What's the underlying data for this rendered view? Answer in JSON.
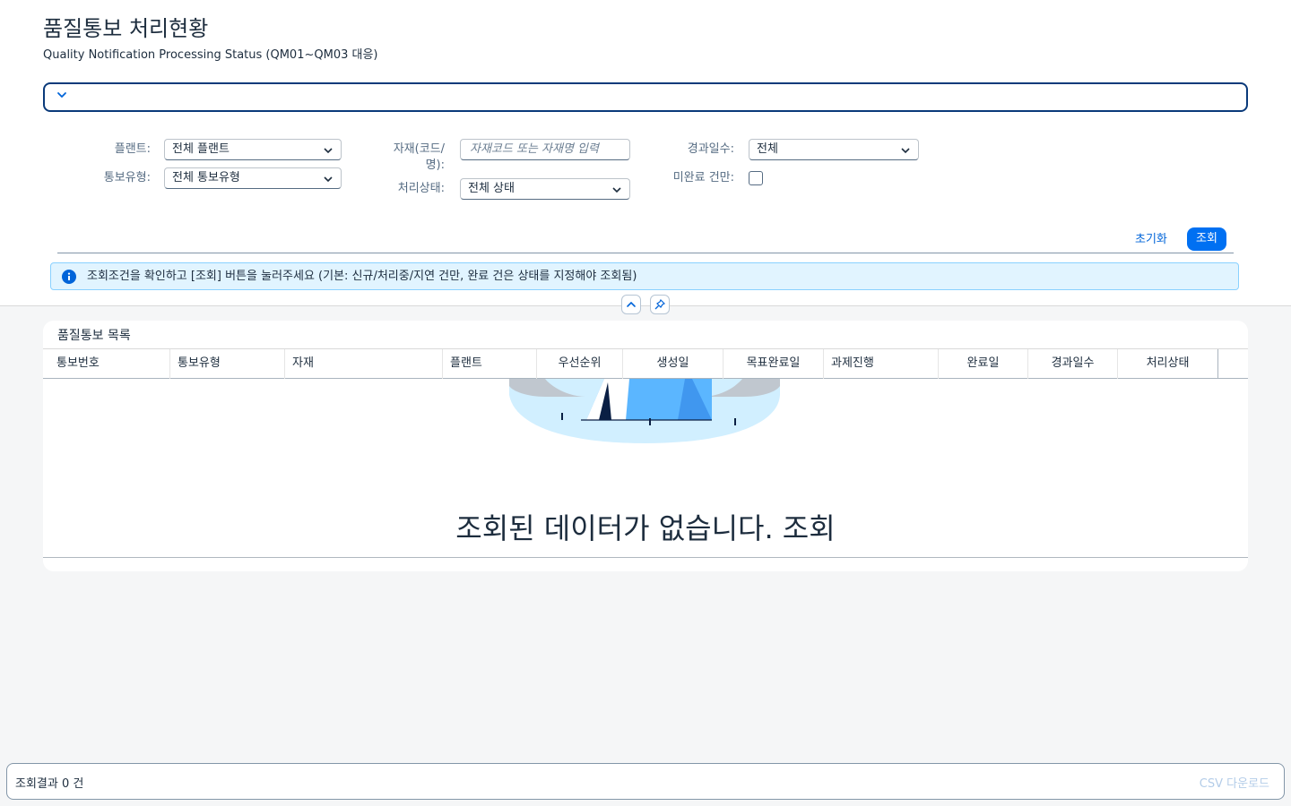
{
  "header": {
    "title": "품질통보 처리현황",
    "subtitle": "Quality Notification Processing Status (QM01~QM03 대응)"
  },
  "filters": {
    "plant": {
      "label": "플랜트:",
      "value": "전체 플랜트"
    },
    "notif_type": {
      "label": "통보유형:",
      "value": "전체 통보유형"
    },
    "material": {
      "label_line1": "자재(코드/",
      "label_line2": "명):",
      "placeholder": "자재코드 또는 자재명 입력"
    },
    "status": {
      "label": "처리상태:",
      "value": "전체 상태"
    },
    "elapsed": {
      "label": "경과일수:",
      "value": "전체"
    },
    "incomplete_only": {
      "label": "미완료 건만:",
      "checked": false
    }
  },
  "actions": {
    "reset_label": "초기화",
    "search_label": "조회"
  },
  "info": {
    "message": "조회조건을 확인하고 [조회] 버튼을 눌러주세요 (기본: 신규/처리중/지연 건만, 완료 건은 상태를 지정해야 조회됨)"
  },
  "table": {
    "title": "품질통보 목록",
    "columns": [
      "통보번호",
      "통보유형",
      "자재",
      "플랜트",
      "우선순위",
      "생성일",
      "목표완료일",
      "과제진행",
      "완료일",
      "경과일수",
      "처리상태"
    ],
    "empty_message": "조회된 데이터가 없습니다. 조회"
  },
  "footer": {
    "result_count": "조회결과 0 건",
    "csv_label": "CSV 다운로드"
  },
  "colors": {
    "accent": "#0070f2",
    "info_bg": "#e1f4ff",
    "brand_dark": "#0a3a7a"
  }
}
